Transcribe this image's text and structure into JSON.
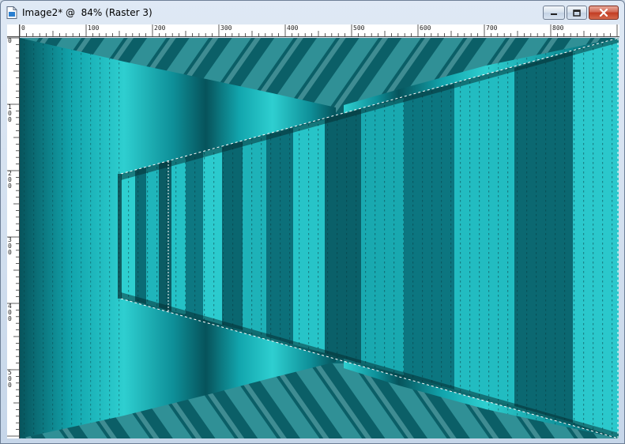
{
  "window": {
    "title": "Image2* @  84% (Raster 3)"
  },
  "icons": {
    "document": "document-icon",
    "minimize": "minimize-icon",
    "maximize": "maximize-icon",
    "close": "close-icon"
  },
  "ruler": {
    "top_labels": [
      "0",
      "100",
      "200",
      "300",
      "400",
      "500",
      "600",
      "700",
      "800"
    ],
    "left_labels": [
      "0",
      "100",
      "200",
      "300",
      "400",
      "500"
    ]
  },
  "colors": {
    "teal_light": "#2ecfd0",
    "teal_mid": "#12a5ad",
    "teal_dark": "#07545c",
    "close_red": "#c23b22"
  }
}
